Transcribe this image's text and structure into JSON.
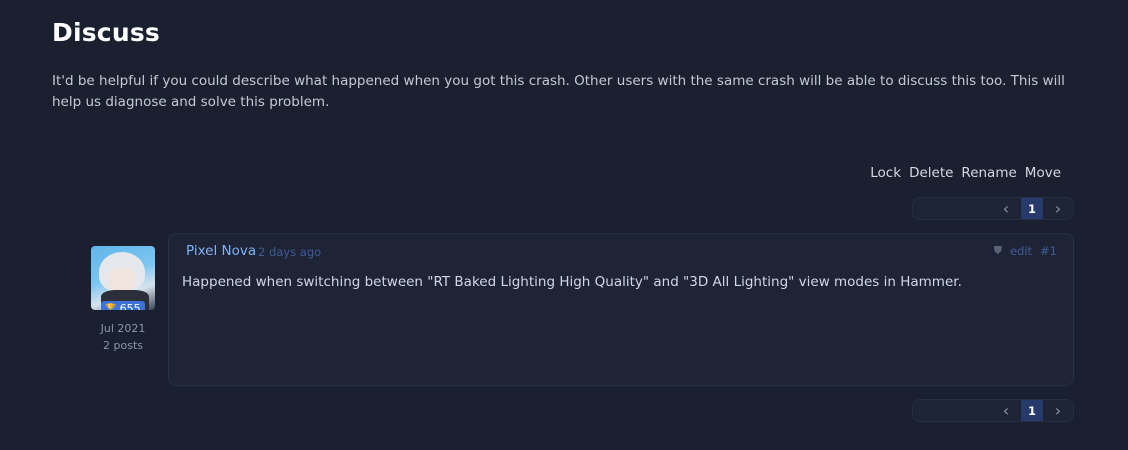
{
  "header": {
    "title": "Discuss",
    "intro": "It'd be helpful if you could describe what happened when you got this crash. Other users with the same crash will be able to discuss this too. This will help us diagnose and solve this problem."
  },
  "actions": {
    "lock": "Lock",
    "delete": "Delete",
    "rename": "Rename",
    "move": "Move"
  },
  "pagination": {
    "prev": "‹",
    "current": "1",
    "next": "›"
  },
  "post": {
    "author": {
      "name": "Pixel Nova",
      "score": "655",
      "joined": "Jul 2021",
      "posts": "2 posts"
    },
    "time": "2 days ago",
    "edit_label": "edit",
    "post_number": "#1",
    "body": "Happened when switching between \"RT Baked Lighting High Quality\" and \"3D All Lighting\" view modes in Hammer."
  },
  "icons": {
    "trophy": "trophy-icon",
    "shield": "shield-icon",
    "prev": "chevron-left-icon",
    "next": "chevron-right-icon"
  }
}
